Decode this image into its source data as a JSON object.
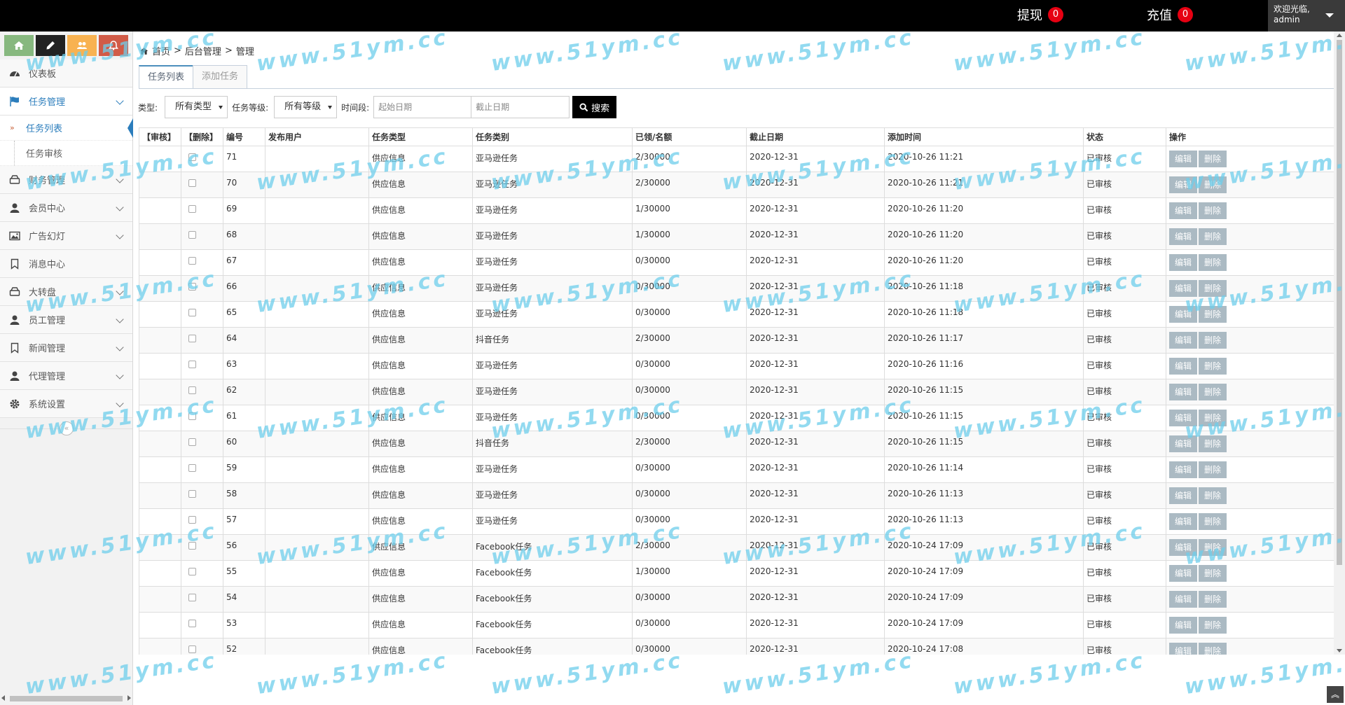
{
  "topbar": {
    "withdraw_label": "提现",
    "withdraw_count": "0",
    "recharge_label": "充值",
    "recharge_count": "0",
    "welcome": "欢迎光临,",
    "username": "admin"
  },
  "shortcuts": [
    "home-icon",
    "pencil-icon",
    "users-icon",
    "bell-icon"
  ],
  "sidebar": {
    "items": [
      {
        "label": "仪表板",
        "icon": "tachometer-icon"
      },
      {
        "label": "任务管理",
        "icon": "flag-icon"
      },
      {
        "label": "财务管理",
        "icon": "hdd-icon"
      },
      {
        "label": "会员中心",
        "icon": "user-icon"
      },
      {
        "label": "广告幻灯",
        "icon": "picture-icon"
      },
      {
        "label": "消息中心",
        "icon": "bookmark-icon"
      },
      {
        "label": "大转盘",
        "icon": "hdd-icon"
      },
      {
        "label": "员工管理",
        "icon": "user-icon"
      },
      {
        "label": "新闻管理",
        "icon": "bookmark-icon"
      },
      {
        "label": "代理管理",
        "icon": "user-icon"
      },
      {
        "label": "系统设置",
        "icon": "cog-icon"
      }
    ],
    "subitems": [
      {
        "label": "任务列表"
      },
      {
        "label": "任务审核"
      }
    ]
  },
  "breadcrumb": {
    "home": "首页",
    "sep": ">",
    "level2": "后台管理",
    "level3": "管理"
  },
  "tabs": [
    {
      "label": "任务列表"
    },
    {
      "label": "添加任务"
    }
  ],
  "filters": {
    "type_label": "类型:",
    "type_value": "所有类型",
    "level_label": "任务等级:",
    "level_value": "所有等级",
    "period_label": "时间段:",
    "start_placeholder": "起始日期",
    "end_placeholder": "截止日期",
    "search_label": "搜索"
  },
  "table": {
    "headers": [
      "【审核】",
      "【删除】",
      "编号",
      "发布用户",
      "任务类型",
      "任务类别",
      "已领/名额",
      "截止日期",
      "添加时间",
      "状态",
      "操作"
    ],
    "edit_label": "编辑",
    "delete_label": "删除",
    "rows": [
      {
        "id": "71",
        "user": "",
        "type": "供应信息",
        "category": "亚马逊任务",
        "quota": "2/30000",
        "deadline": "2020-12-31",
        "added": "2020-10-26 11:21",
        "status": "已审核"
      },
      {
        "id": "70",
        "user": "",
        "type": "供应信息",
        "category": "亚马逊任务",
        "quota": "2/30000",
        "deadline": "2020-12-31",
        "added": "2020-10-26 11:21",
        "status": "已审核"
      },
      {
        "id": "69",
        "user": "",
        "type": "供应信息",
        "category": "亚马逊任务",
        "quota": "1/30000",
        "deadline": "2020-12-31",
        "added": "2020-10-26 11:20",
        "status": "已审核"
      },
      {
        "id": "68",
        "user": "",
        "type": "供应信息",
        "category": "亚马逊任务",
        "quota": "1/30000",
        "deadline": "2020-12-31",
        "added": "2020-10-26 11:20",
        "status": "已审核"
      },
      {
        "id": "67",
        "user": "",
        "type": "供应信息",
        "category": "亚马逊任务",
        "quota": "0/30000",
        "deadline": "2020-12-31",
        "added": "2020-10-26 11:20",
        "status": "已审核"
      },
      {
        "id": "66",
        "user": "",
        "type": "供应信息",
        "category": "亚马逊任务",
        "quota": "0/30000",
        "deadline": "2020-12-31",
        "added": "2020-10-26 11:18",
        "status": "已审核"
      },
      {
        "id": "65",
        "user": "",
        "type": "供应信息",
        "category": "亚马逊任务",
        "quota": "0/30000",
        "deadline": "2020-12-31",
        "added": "2020-10-26 11:18",
        "status": "已审核"
      },
      {
        "id": "64",
        "user": "",
        "type": "供应信息",
        "category": "抖音任务",
        "quota": "2/30000",
        "deadline": "2020-12-31",
        "added": "2020-10-26 11:17",
        "status": "已审核"
      },
      {
        "id": "63",
        "user": "",
        "type": "供应信息",
        "category": "亚马逊任务",
        "quota": "0/30000",
        "deadline": "2020-12-31",
        "added": "2020-10-26 11:16",
        "status": "已审核"
      },
      {
        "id": "62",
        "user": "",
        "type": "供应信息",
        "category": "亚马逊任务",
        "quota": "0/30000",
        "deadline": "2020-12-31",
        "added": "2020-10-26 11:15",
        "status": "已审核"
      },
      {
        "id": "61",
        "user": "",
        "type": "供应信息",
        "category": "亚马逊任务",
        "quota": "0/30000",
        "deadline": "2020-12-31",
        "added": "2020-10-26 11:15",
        "status": "已审核"
      },
      {
        "id": "60",
        "user": "",
        "type": "供应信息",
        "category": "抖音任务",
        "quota": "2/30000",
        "deadline": "2020-12-31",
        "added": "2020-10-26 11:15",
        "status": "已审核"
      },
      {
        "id": "59",
        "user": "",
        "type": "供应信息",
        "category": "亚马逊任务",
        "quota": "0/30000",
        "deadline": "2020-12-31",
        "added": "2020-10-26 11:14",
        "status": "已审核"
      },
      {
        "id": "58",
        "user": "",
        "type": "供应信息",
        "category": "亚马逊任务",
        "quota": "0/30000",
        "deadline": "2020-12-31",
        "added": "2020-10-26 11:13",
        "status": "已审核"
      },
      {
        "id": "57",
        "user": "",
        "type": "供应信息",
        "category": "亚马逊任务",
        "quota": "0/30000",
        "deadline": "2020-12-31",
        "added": "2020-10-26 11:13",
        "status": "已审核"
      },
      {
        "id": "56",
        "user": "",
        "type": "供应信息",
        "category": "Facebook任务",
        "quota": "2/30000",
        "deadline": "2020-12-31",
        "added": "2020-10-24 17:09",
        "status": "已审核"
      },
      {
        "id": "55",
        "user": "",
        "type": "供应信息",
        "category": "Facebook任务",
        "quota": "1/30000",
        "deadline": "2020-12-31",
        "added": "2020-10-24 17:09",
        "status": "已审核"
      },
      {
        "id": "54",
        "user": "",
        "type": "供应信息",
        "category": "Facebook任务",
        "quota": "0/30000",
        "deadline": "2020-12-31",
        "added": "2020-10-24 17:09",
        "status": "已审核"
      },
      {
        "id": "53",
        "user": "",
        "type": "供应信息",
        "category": "Facebook任务",
        "quota": "0/30000",
        "deadline": "2020-12-31",
        "added": "2020-10-24 17:09",
        "status": "已审核"
      },
      {
        "id": "52",
        "user": "",
        "type": "供应信息",
        "category": "Facebook任务",
        "quota": "0/30000",
        "deadline": "2020-12-31",
        "added": "2020-10-24 17:08",
        "status": "已审核"
      }
    ]
  },
  "watermark": "www.51ym.cc",
  "colors": {
    "accent": "#2b7dbc",
    "badge": "#e60012",
    "op_button": "#abbac3"
  }
}
